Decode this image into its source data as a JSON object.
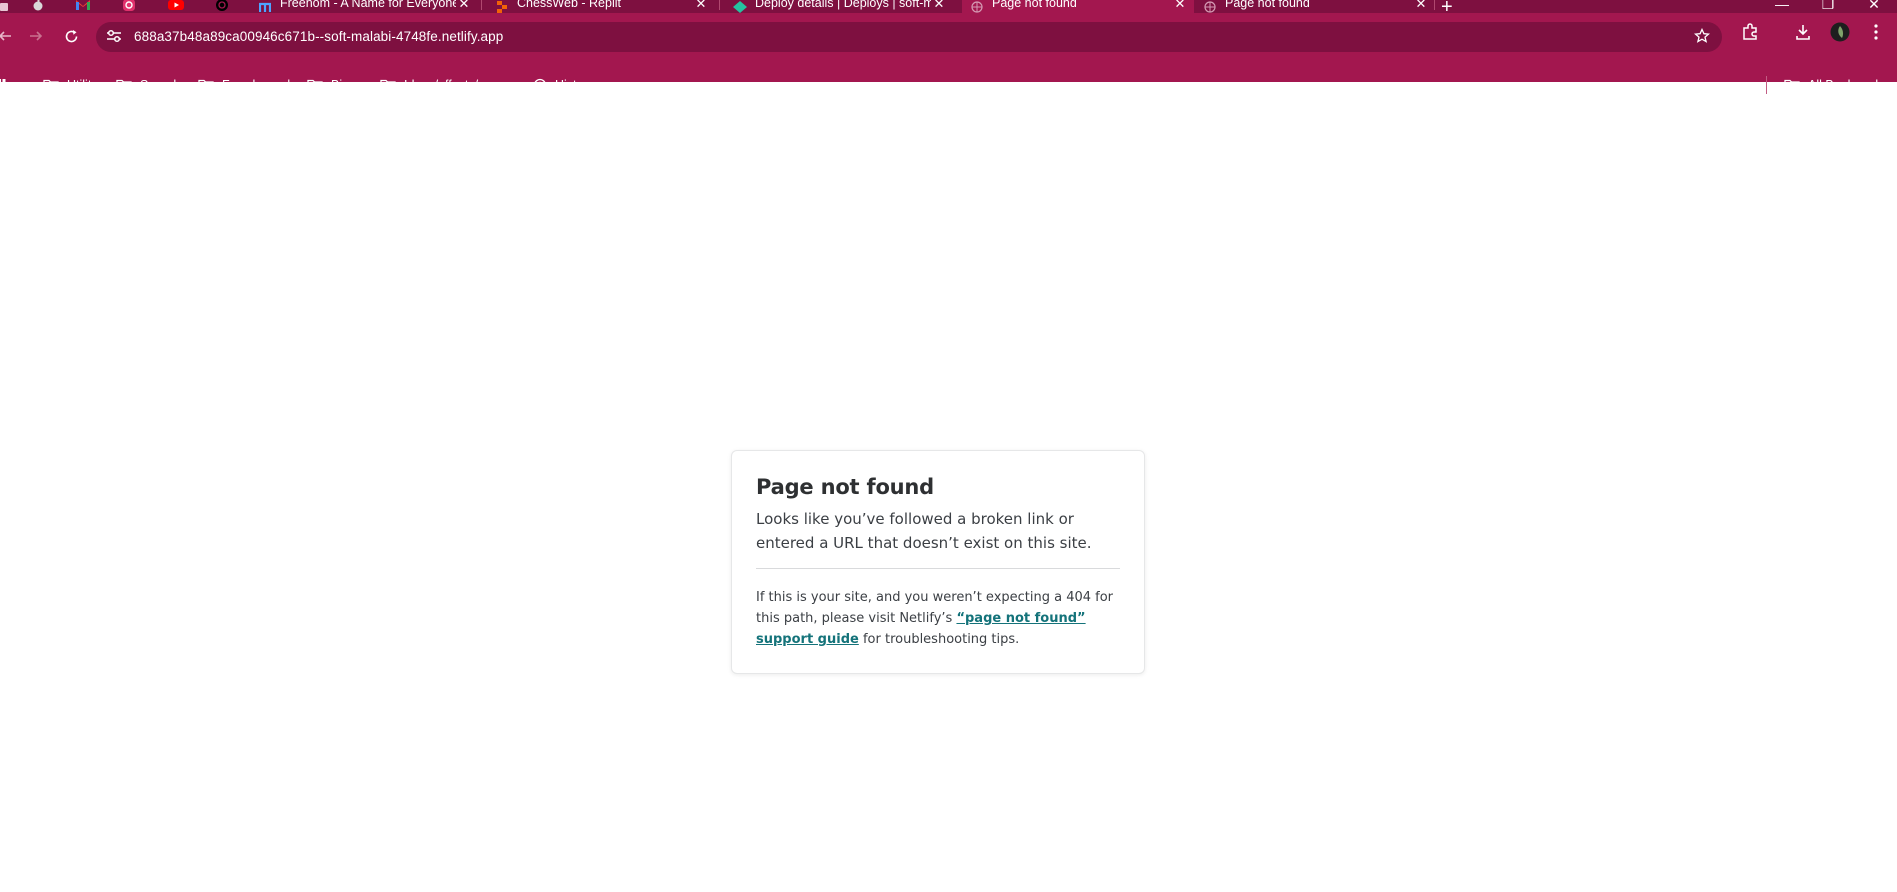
{
  "browser": {
    "accent_color": "#a3174f",
    "tabstrip_color": "#7e1040",
    "pinned_tabs": [
      {
        "icon": "apple-icon"
      },
      {
        "icon": "gmail-icon"
      },
      {
        "icon": "instagram-icon"
      },
      {
        "icon": "youtube-icon"
      },
      {
        "icon": "threads-icon"
      }
    ],
    "tabs": [
      {
        "title": "Freenom - A Name for Everyone",
        "icon": "freenom-icon",
        "close": "✕"
      },
      {
        "title": "ChessWeb - Replit",
        "icon": "replit-icon",
        "close": "✕"
      },
      {
        "title": "Deploy details | Deploys | soft-malabi",
        "icon": "netlify-icon",
        "close": "✕"
      },
      {
        "title": "Page not found",
        "icon": "globe-icon",
        "close": "✕",
        "active": true
      },
      {
        "title": "Page not found",
        "icon": "globe-icon",
        "close": "✕"
      }
    ],
    "new_tab": "+",
    "window_controls": {
      "minimize": "—",
      "restore": "❐",
      "close": "✕"
    },
    "address_bar": {
      "url": "688a37b48a89ca00946c671b--soft-malabi-4748fe.netlify.app"
    },
    "bookmarks": [
      {
        "label": "Utility",
        "icon": "folder-icon"
      },
      {
        "label": "Sounds",
        "icon": "folder-icon"
      },
      {
        "label": "Fav channels",
        "icon": "folder-icon"
      },
      {
        "label": "Binge",
        "icon": "folder-icon"
      },
      {
        "label": "Ideas/effects/scenc...",
        "icon": "folder-icon"
      },
      {
        "label": "History",
        "icon": "history-icon"
      }
    ],
    "all_bookmarks": "All Bookmarks"
  },
  "page": {
    "heading": "Page not found",
    "lead": "Looks like you’ve followed a broken link or entered a URL that doesn’t exist on this site.",
    "help_before": "If this is your site, and you weren’t expecting a 404 for this path, please visit Netlify’s ",
    "help_link": "“page not found” support guide",
    "help_after": " for troubleshooting tips."
  }
}
